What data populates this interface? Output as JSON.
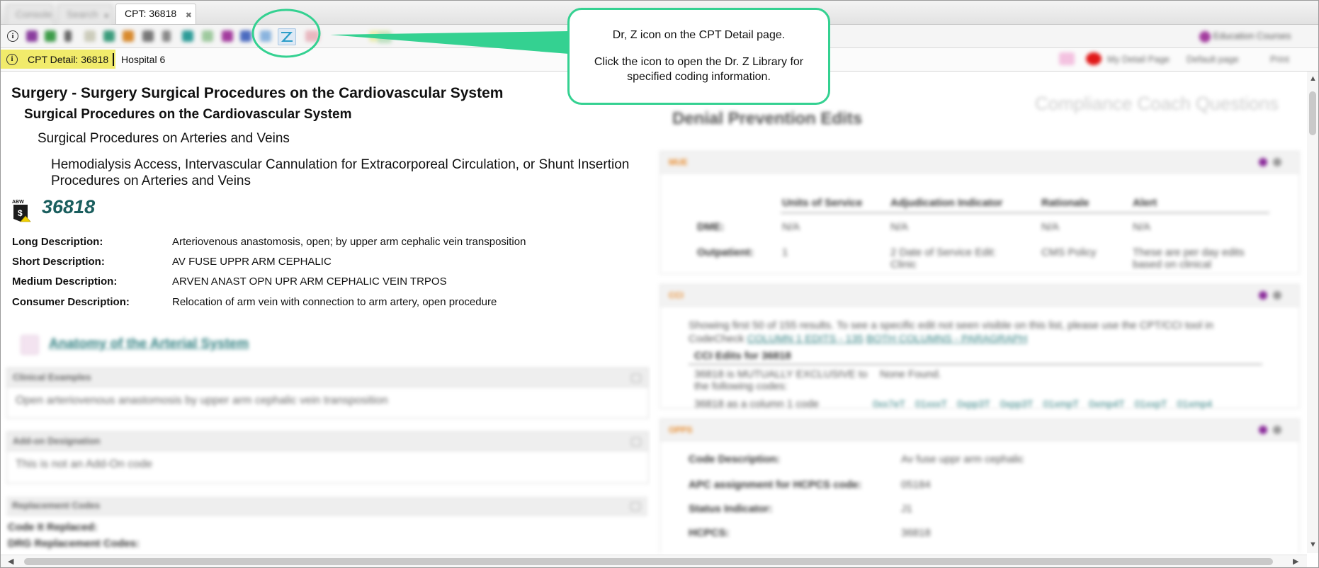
{
  "tabs": [
    {
      "label": "Console",
      "active": false
    },
    {
      "label": "Search",
      "active": false
    },
    {
      "label": "CPT: 36818",
      "active": true
    }
  ],
  "toolbar": {
    "info_icon": "info-icon",
    "drz_icon": "dr-z-library-icon",
    "right_label": "Education Courses",
    "right_icon": "education-courses-icon"
  },
  "breadcrumb": {
    "primary": "CPT Detail: 36818",
    "secondary": "Hospital 6",
    "actions": [
      "My Detail Page",
      "Default page",
      "Print"
    ]
  },
  "hierarchy": {
    "level1": "Surgery - Surgery Surgical Procedures on the Cardiovascular System",
    "level2": "Surgical Procedures on the Cardiovascular System",
    "level3": "Surgical Procedures on Arteries and Veins",
    "level4": "Hemodialysis Access, Intervascular Cannulation for Extracorporeal Circulation, or Shunt Insertion Procedures on Arteries and Veins"
  },
  "code": {
    "number": "36818",
    "badge_icon": "abw-dollar-icon",
    "badge_text": "ABW"
  },
  "descriptions": [
    {
      "label": "Long Description:",
      "value": "Arteriovenous anastomosis, open; by upper arm cephalic vein transposition"
    },
    {
      "label": "Short Description:",
      "value": "AV FUSE UPPR ARM CEPHALIC"
    },
    {
      "label": "Medium Description:",
      "value": "ARVEN ANAST OPN UPR ARM CEPHALIC VEIN TRPOS"
    },
    {
      "label": "Consumer Description:",
      "value": "Relocation of arm vein with connection to arm artery, open procedure"
    }
  ],
  "anatomy_link": "Anatomy of the Arterial System",
  "left_panels": [
    {
      "title": "Clinical Examples",
      "body": "Open arteriovenous anastomosis by upper arm cephalic vein transposition"
    },
    {
      "title": "Add-on Designation",
      "body": "This is not an Add-On code"
    },
    {
      "title": "Replacement Codes",
      "body": "Code It Replaced:",
      "body2": "DRG Replacement Codes:"
    }
  ],
  "right": {
    "compliance_title": "Compliance Coach Questions",
    "denial_title": "Denial Prevention Edits",
    "mue": {
      "tag": "MUE",
      "columns": [
        "Units of Service",
        "Adjudication Indicator",
        "Rationale",
        "Alert"
      ],
      "rows": [
        {
          "label": "DME:",
          "cells": [
            "N/A",
            "N/A",
            "N/A",
            "N/A"
          ]
        },
        {
          "label": "Outpatient:",
          "cells": [
            "1",
            "2 Date of Service Edit: Clinic",
            "CMS Policy",
            "These are per day edits based on clinical"
          ]
        }
      ]
    },
    "cci": {
      "tag": "CCI",
      "intro": "Showing first 50 of 155 results. To see a specific edit not seen visible on this list, please use the CPT/CCI tool in CodeCheck",
      "links": [
        "COLUMN 1 EDITS - 135",
        "BOTH COLUMNS - PARAGRAPH"
      ],
      "heading": "CCI Edits for 36818",
      "r1a": "36818 is MUTUALLY EXCLUSIVE to the following codes:",
      "r1b": "None Found.",
      "r2a": "36818 as a column 1 code",
      "r2_codes": [
        "0xx7eT",
        "01xxxT",
        "0xpp3T",
        "0xpp3T",
        "01xmpT",
        "0xmp4T",
        "01xxpT",
        "01xmp4"
      ]
    },
    "opps": {
      "tag": "OPPS",
      "rows": [
        {
          "label": "Code Description:",
          "value": "Av fuse uppr arm cephalic"
        },
        {
          "label": "APC assignment for HCPCS code:",
          "value": "05184"
        },
        {
          "label": "Status Indicator:",
          "value": "J1"
        },
        {
          "label": "HCPCS:",
          "value": "36818"
        }
      ]
    }
  },
  "callout": {
    "line1": "Dr, Z icon on the CPT Detail page.",
    "line2": "Click the icon to open the Dr. Z Library for specified coding information."
  },
  "colors": {
    "callout_border": "#34d191",
    "breadcrumb_highlight": "#f1eb6b",
    "code_number": "#1a5e5e",
    "link_teal": "#2f7f80"
  }
}
